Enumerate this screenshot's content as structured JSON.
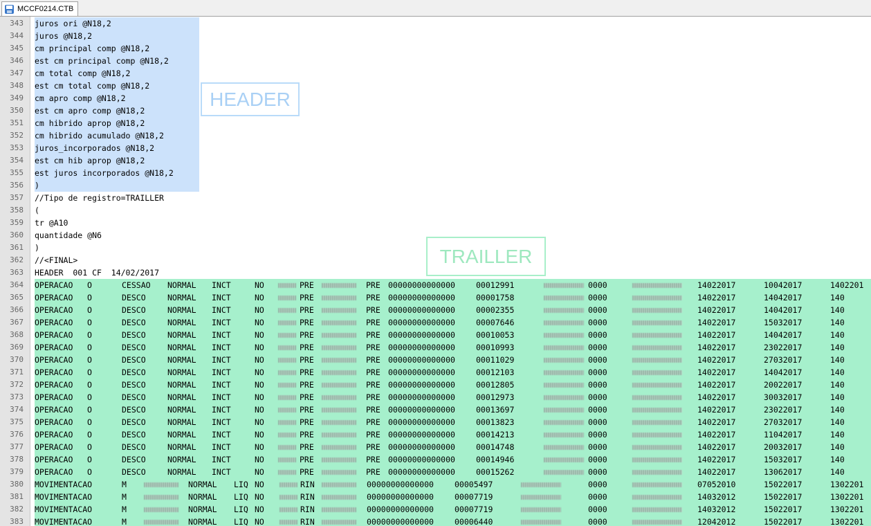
{
  "tab": {
    "title": "MCCF0214.CTB",
    "icon": "save-disk-icon"
  },
  "overlays": {
    "header": "HEADER",
    "trailler": "TRAILLER"
  },
  "colors": {
    "header_highlight": "#cce2fb",
    "trailler_highlight": "#a6f0cc",
    "gutter": "#e4e4e4"
  },
  "lines": [
    {
      "n": "343",
      "text": "juros ori @N18,2",
      "hl": "h"
    },
    {
      "n": "344",
      "text": "juros @N18,2",
      "hl": "h"
    },
    {
      "n": "345",
      "text": "cm principal comp @N18,2",
      "hl": "h"
    },
    {
      "n": "346",
      "text": "est cm principal comp @N18,2",
      "hl": "h"
    },
    {
      "n": "347",
      "text": "cm total comp @N18,2",
      "hl": "h"
    },
    {
      "n": "348",
      "text": "est cm total comp @N18,2",
      "hl": "h"
    },
    {
      "n": "349",
      "text": "cm apro comp @N18,2",
      "hl": "h"
    },
    {
      "n": "350",
      "text": "est cm apro comp @N18,2",
      "hl": "h"
    },
    {
      "n": "351",
      "text": "cm hibrido aprop @N18,2",
      "hl": "h"
    },
    {
      "n": "352",
      "text": "cm hibrido acumulado @N18,2",
      "hl": "h"
    },
    {
      "n": "353",
      "text": "juros_incorporados @N18,2",
      "hl": "h"
    },
    {
      "n": "354",
      "text": "est cm hib aprop @N18,2",
      "hl": "h"
    },
    {
      "n": "355",
      "text": "est juros incorporados @N18,2",
      "hl": "h"
    },
    {
      "n": "356",
      "text": ")",
      "hl": "h"
    },
    {
      "n": "357",
      "text": "//Tipo de registro=TRAILLER",
      "hl": ""
    },
    {
      "n": "358",
      "text": "(",
      "hl": ""
    },
    {
      "n": "359",
      "text": "tr @A10",
      "hl": ""
    },
    {
      "n": "360",
      "text": "quantidade @N6",
      "hl": ""
    },
    {
      "n": "361",
      "text": ")",
      "hl": ""
    },
    {
      "n": "362",
      "text": "//<FINAL>",
      "hl": ""
    },
    {
      "n": "363",
      "text": "HEADER  001 CF  14/02/2017",
      "hl": ""
    },
    {
      "n": "364",
      "hl": "t",
      "cells": [
        "OPERACAO",
        "O",
        "CESSAO",
        "NORMAL",
        "INCT",
        "NO",
        "",
        "PRE",
        "",
        "PRE",
        "00000000000000",
        "00012991",
        "",
        "0000",
        "",
        "14022017",
        "10042017",
        "1402201"
      ]
    },
    {
      "n": "365",
      "hl": "t",
      "cells": [
        "OPERACAO",
        "O",
        "DESCO",
        "NORMAL",
        "INCT",
        "NO",
        "",
        "PRE",
        "",
        "PRE",
        "00000000000000",
        "00001758",
        "",
        "0000",
        "",
        "14022017",
        "14042017",
        "140"
      ]
    },
    {
      "n": "366",
      "hl": "t",
      "cells": [
        "OPERACAO",
        "O",
        "DESCO",
        "NORMAL",
        "INCT",
        "NO",
        "",
        "PRE",
        "",
        "PRE",
        "00000000000000",
        "00002355",
        "",
        "0000",
        "",
        "14022017",
        "14042017",
        "140"
      ]
    },
    {
      "n": "367",
      "hl": "t",
      "cells": [
        "OPERACAO",
        "O",
        "DESCO",
        "NORMAL",
        "INCT",
        "NO",
        "",
        "PRE",
        "",
        "PRE",
        "00000000000000",
        "00007646",
        "",
        "0000",
        "",
        "14022017",
        "15032017",
        "140"
      ]
    },
    {
      "n": "368",
      "hl": "t",
      "cells": [
        "OPERACAO",
        "O",
        "DESCO",
        "NORMAL",
        "INCT",
        "NO",
        "",
        "PRE",
        "",
        "PRE",
        "00000000000000",
        "00010053",
        "",
        "0000",
        "",
        "14022017",
        "14042017",
        "140"
      ]
    },
    {
      "n": "369",
      "hl": "t",
      "cells": [
        "OPERACAO",
        "O",
        "DESCO",
        "NORMAL",
        "INCT",
        "NO",
        "",
        "PRE",
        "",
        "PRE",
        "00000000000000",
        "00010993",
        "",
        "0000",
        "",
        "14022017",
        "23022017",
        "140"
      ]
    },
    {
      "n": "370",
      "hl": "t",
      "cells": [
        "OPERACAO",
        "O",
        "DESCO",
        "NORMAL",
        "INCT",
        "NO",
        "",
        "PRE",
        "",
        "PRE",
        "00000000000000",
        "00011029",
        "",
        "0000",
        "",
        "14022017",
        "27032017",
        "140"
      ]
    },
    {
      "n": "371",
      "hl": "t",
      "cells": [
        "OPERACAO",
        "O",
        "DESCO",
        "NORMAL",
        "INCT",
        "NO",
        "",
        "PRE",
        "",
        "PRE",
        "00000000000000",
        "00012103",
        "",
        "0000",
        "",
        "14022017",
        "14042017",
        "140"
      ]
    },
    {
      "n": "372",
      "hl": "t",
      "cells": [
        "OPERACAO",
        "O",
        "DESCO",
        "NORMAL",
        "INCT",
        "NO",
        "",
        "PRE",
        "",
        "PRE",
        "00000000000000",
        "00012805",
        "",
        "0000",
        "",
        "14022017",
        "20022017",
        "140"
      ]
    },
    {
      "n": "373",
      "hl": "t",
      "cells": [
        "OPERACAO",
        "O",
        "DESCO",
        "NORMAL",
        "INCT",
        "NO",
        "",
        "PRE",
        "",
        "PRE",
        "00000000000000",
        "00012973",
        "",
        "0000",
        "",
        "14022017",
        "30032017",
        "140"
      ]
    },
    {
      "n": "374",
      "hl": "t",
      "cells": [
        "OPERACAO",
        "O",
        "DESCO",
        "NORMAL",
        "INCT",
        "NO",
        "",
        "PRE",
        "",
        "PRE",
        "00000000000000",
        "00013697",
        "",
        "0000",
        "",
        "14022017",
        "23022017",
        "140"
      ]
    },
    {
      "n": "375",
      "hl": "t",
      "cells": [
        "OPERACAO",
        "O",
        "DESCO",
        "NORMAL",
        "INCT",
        "NO",
        "",
        "PRE",
        "",
        "PRE",
        "00000000000000",
        "00013823",
        "",
        "0000",
        "",
        "14022017",
        "27032017",
        "140"
      ]
    },
    {
      "n": "376",
      "hl": "t",
      "cells": [
        "OPERACAO",
        "O",
        "DESCO",
        "NORMAL",
        "INCT",
        "NO",
        "",
        "PRE",
        "",
        "PRE",
        "00000000000000",
        "00014213",
        "",
        "0000",
        "",
        "14022017",
        "11042017",
        "140"
      ]
    },
    {
      "n": "377",
      "hl": "t",
      "cells": [
        "OPERACAO",
        "O",
        "DESCO",
        "NORMAL",
        "INCT",
        "NO",
        "",
        "PRE",
        "",
        "PRE",
        "00000000000000",
        "00014748",
        "",
        "0000",
        "",
        "14022017",
        "20032017",
        "140"
      ]
    },
    {
      "n": "378",
      "hl": "t",
      "cells": [
        "OPERACAO",
        "O",
        "DESCO",
        "NORMAL",
        "INCT",
        "NO",
        "",
        "PRE",
        "",
        "PRE",
        "00000000000000",
        "00014946",
        "",
        "0000",
        "",
        "14022017",
        "15032017",
        "140"
      ]
    },
    {
      "n": "379",
      "hl": "t",
      "cells": [
        "OPERACAO",
        "O",
        "DESCO",
        "NORMAL",
        "INCT",
        "NO",
        "",
        "PRE",
        "",
        "PRE",
        "00000000000000",
        "00015262",
        "",
        "0000",
        "",
        "14022017",
        "13062017",
        "140"
      ]
    },
    {
      "n": "380",
      "hl": "t",
      "cells": [
        "MOVIMENTACAO",
        "M",
        "",
        "NORMAL",
        "LIQ",
        "NO",
        "",
        "RIN",
        "",
        "",
        "00000000000000",
        "00005497",
        "",
        "0000",
        "",
        "07052010",
        "15022017",
        "1302201"
      ]
    },
    {
      "n": "381",
      "hl": "t",
      "cells": [
        "MOVIMENTACAO",
        "M",
        "",
        "NORMAL",
        "LIQ",
        "NO",
        "",
        "RIN",
        "",
        "",
        "00000000000000",
        "00007719",
        "",
        "0000",
        "",
        "14032012",
        "15022017",
        "1302201"
      ]
    },
    {
      "n": "382",
      "hl": "t",
      "cells": [
        "MOVIMENTACAO",
        "M",
        "",
        "NORMAL",
        "LIQ",
        "NO",
        "",
        "RIN",
        "",
        "",
        "00000000000000",
        "00007719",
        "",
        "0000",
        "",
        "14032012",
        "15022017",
        "1302201"
      ]
    },
    {
      "n": "383",
      "hl": "t",
      "cells": [
        "MOVIMENTACAO",
        "M",
        "",
        "NORMAL",
        "LIQ",
        "NO",
        "",
        "RIN",
        "",
        "",
        "00000000000000",
        "00006440",
        "",
        "0000",
        "",
        "12042012",
        "15022017",
        "1302201"
      ]
    }
  ]
}
